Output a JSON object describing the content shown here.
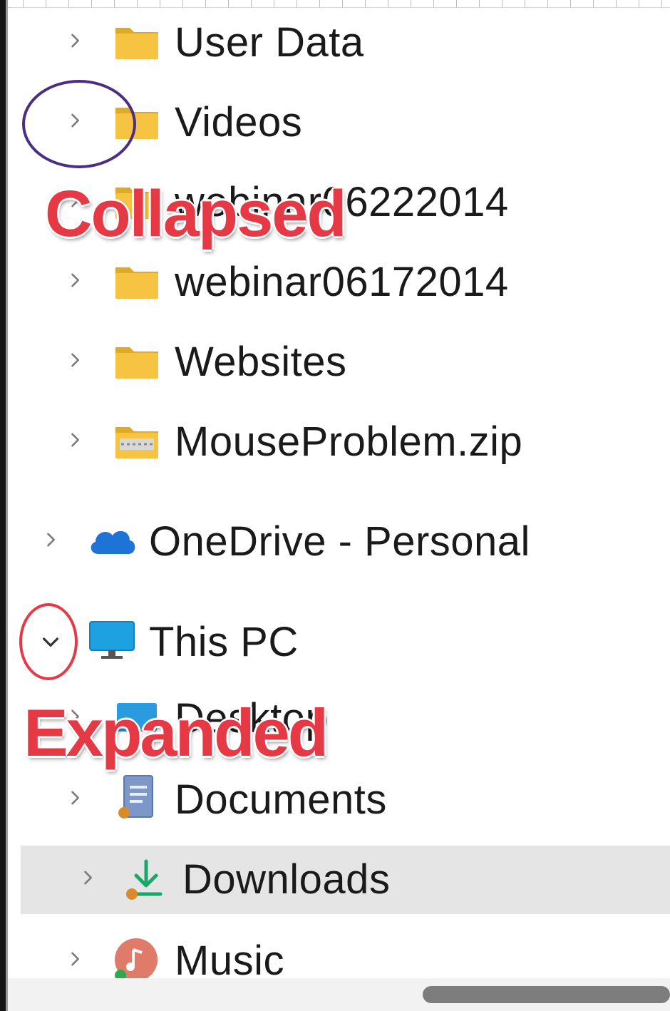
{
  "nav_tree": {
    "items": [
      {
        "label": "User Data",
        "icon": "folder-icon",
        "state": "collapsed"
      },
      {
        "label": "Videos",
        "icon": "folder-icon",
        "state": "collapsed"
      },
      {
        "label": "webinar06222014",
        "icon": "folder-icon",
        "state": "collapsed"
      },
      {
        "label": "webinar06172014",
        "icon": "folder-icon",
        "state": "collapsed"
      },
      {
        "label": "Websites",
        "icon": "folder-icon",
        "state": "collapsed"
      },
      {
        "label": "MouseProblem.zip",
        "icon": "zip-folder-icon",
        "state": "collapsed"
      },
      {
        "label": "OneDrive - Personal",
        "icon": "onedrive-cloud-icon",
        "state": "collapsed"
      },
      {
        "label": "This PC",
        "icon": "monitor-icon",
        "state": "expanded"
      },
      {
        "label": "Desktop",
        "icon": "desktop-folder-icon",
        "state": "collapsed"
      },
      {
        "label": "Documents",
        "icon": "documents-icon",
        "state": "collapsed"
      },
      {
        "label": "Downloads",
        "icon": "download-arrow-icon",
        "state": "collapsed",
        "selected": true
      },
      {
        "label": "Music",
        "icon": "music-icon",
        "state": "collapsed"
      }
    ]
  },
  "annotations": {
    "collapsed_label": "Collapsed",
    "expanded_label": "Expanded",
    "collapsed_circle_color": "#4b2e83",
    "expanded_circle_color": "#e63946"
  },
  "colors": {
    "folder": "#f6c343",
    "folder_dark": "#e0a926",
    "selection": "#e5e5e5",
    "annotation_text": "#e63946",
    "onedrive": "#1e73d6",
    "monitor": "#1da1e0",
    "download": "#1aa86a"
  }
}
